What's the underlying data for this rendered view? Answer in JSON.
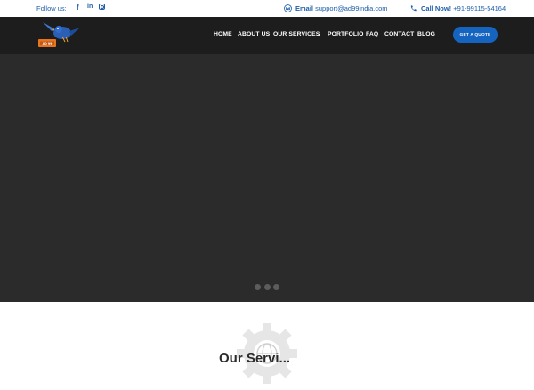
{
  "topbar": {
    "follow_label": "Follow us:",
    "social": [
      {
        "name": "facebook",
        "glyph": "f"
      },
      {
        "name": "linkedin",
        "glyph": "in"
      },
      {
        "name": "instagram",
        "glyph": ""
      }
    ],
    "email_label": "Email",
    "email_value": "support@ad99india.com",
    "phone_label": "Call Now!",
    "phone_value": "+91-99115-54164"
  },
  "nav": {
    "items": [
      "HOME",
      "ABOUT US",
      "OUR SERVICES",
      "PORTFOLIO",
      "FAQ",
      "CONTACT",
      "BLOG"
    ],
    "caret": "⌄",
    "quote_button": "GET A QUOTE"
  },
  "slider": {
    "dots": 3
  },
  "services": {
    "title": "Our Servi..."
  },
  "colors": {
    "accent": "#1565c0",
    "link": "#1e5ea8",
    "header_bg": "#1d1d1d",
    "hero_bg": "#2b2b2b"
  }
}
